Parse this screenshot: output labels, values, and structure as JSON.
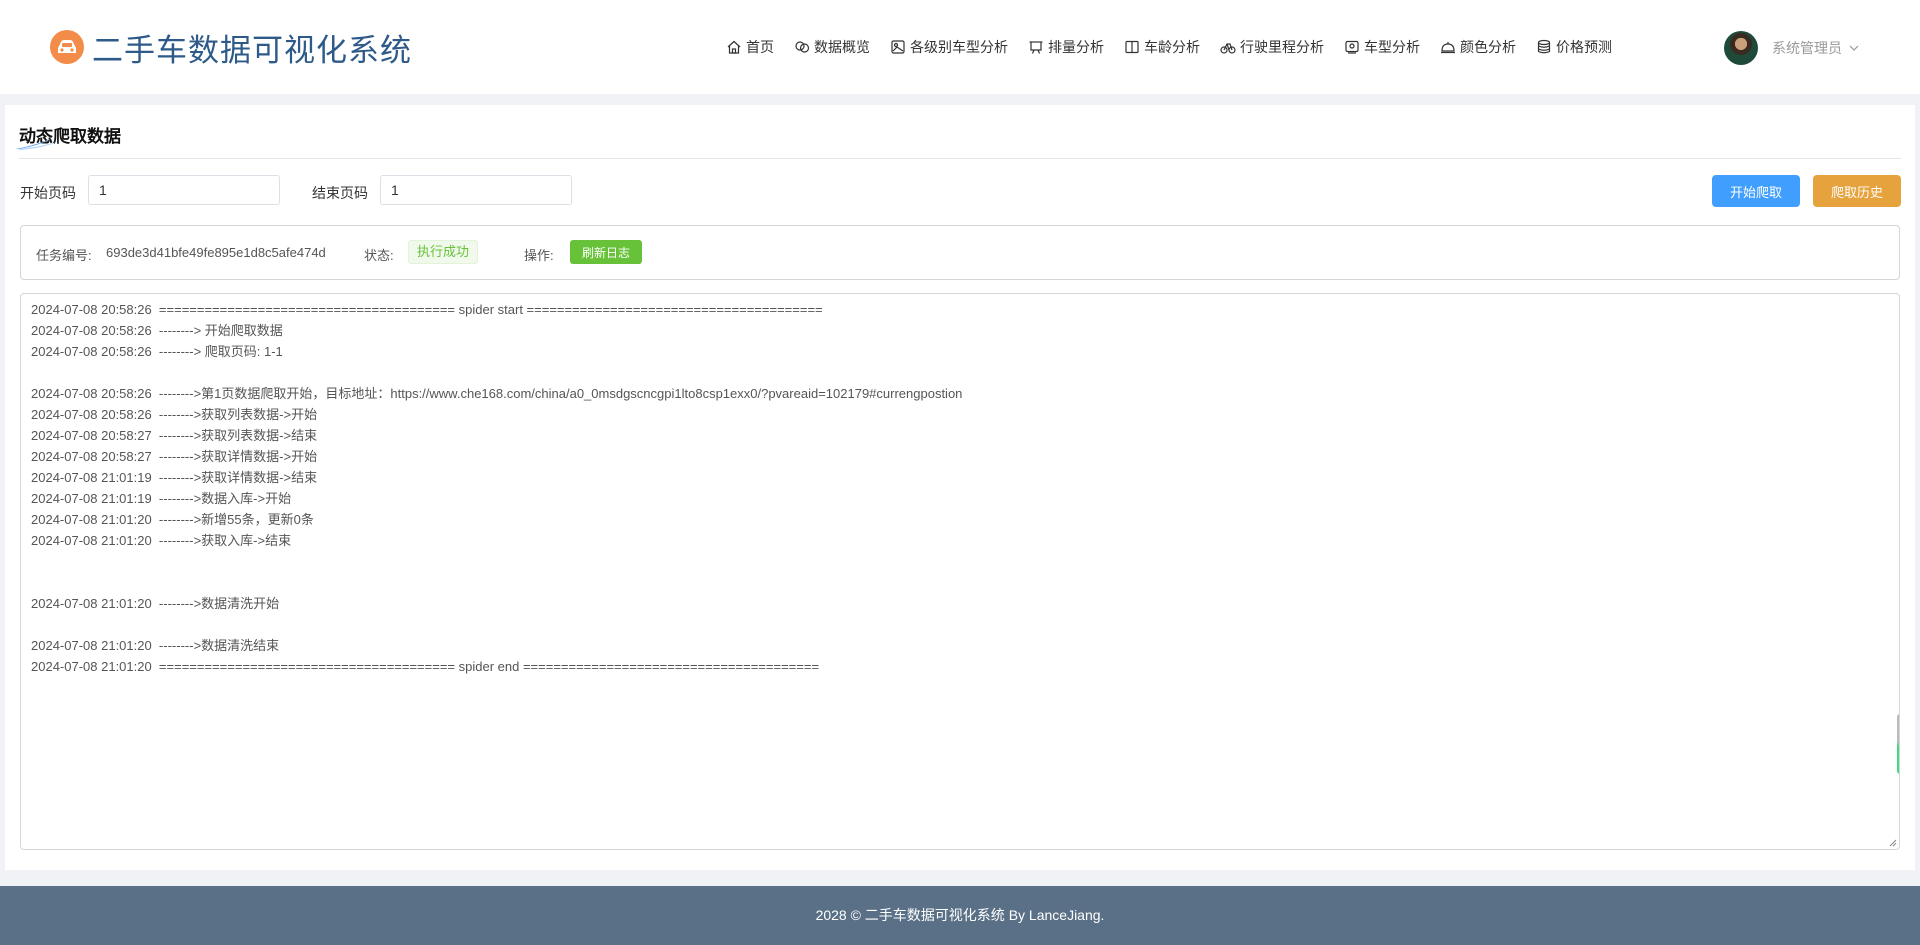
{
  "app": {
    "title": "二手车数据可视化系统"
  },
  "nav": [
    {
      "label": "首页",
      "icon": "home-icon"
    },
    {
      "label": "数据概览",
      "icon": "overview-icon"
    },
    {
      "label": "各级别车型分析",
      "icon": "level-icon"
    },
    {
      "label": "排量分析",
      "icon": "displacement-icon"
    },
    {
      "label": "车龄分析",
      "icon": "book-icon"
    },
    {
      "label": "行驶里程分析",
      "icon": "bicycle-icon"
    },
    {
      "label": "车型分析",
      "icon": "car-model-icon"
    },
    {
      "label": "颜色分析",
      "icon": "dish-icon"
    },
    {
      "label": "价格预测",
      "icon": "coin-stack-icon"
    }
  ],
  "user": {
    "name": "系统管理员"
  },
  "page": {
    "title": "动态爬取数据"
  },
  "form": {
    "start_label": "开始页码",
    "start_value": "1",
    "end_label": "结束页码",
    "end_value": "1",
    "start_button": "开始爬取",
    "history_button": "爬取历史"
  },
  "task": {
    "id_label": "任务编号:",
    "id_value": "693de3d41bfe49fe895e1d8c5afe474d",
    "status_label": "状态:",
    "status_value": "执行成功",
    "ops_label": "操作:",
    "refresh_button": "刷新日志"
  },
  "log": [
    "2024-07-08 20:58:26  ======================================= spider start =======================================",
    "2024-07-08 20:58:26  --------> 开始爬取数据",
    "2024-07-08 20:58:26  --------> 爬取页码: 1-1",
    "",
    "2024-07-08 20:58:26  -------->第1页数据爬取开始，目标地址：https://www.che168.com/china/a0_0msdgscncgpi1lto8csp1exx0/?pvareaid=102179#currengpostion",
    "2024-07-08 20:58:26  -------->获取列表数据->开始",
    "2024-07-08 20:58:27  -------->获取列表数据->结束",
    "2024-07-08 20:58:27  -------->获取详情数据->开始",
    "2024-07-08 21:01:19  -------->获取详情数据->结束",
    "2024-07-08 21:01:19  -------->数据入库->开始",
    "2024-07-08 21:01:20  -------->新增55条，更新0条",
    "2024-07-08 21:01:20  -------->获取入库->结束",
    "",
    "",
    "2024-07-08 21:01:20  -------->数据清洗开始",
    "",
    "2024-07-08 21:01:20  -------->数据清洗结束",
    "2024-07-08 21:01:20  ======================================= spider end ======================================="
  ],
  "footer": {
    "text": "2028 © 二手车数据可视化系统 By LanceJiang."
  },
  "colors": {
    "primary": "#409eff",
    "warning": "#e6a23c",
    "success": "#67c23a",
    "footer_bg": "#5a7086",
    "logo_text": "#2d5a88"
  }
}
